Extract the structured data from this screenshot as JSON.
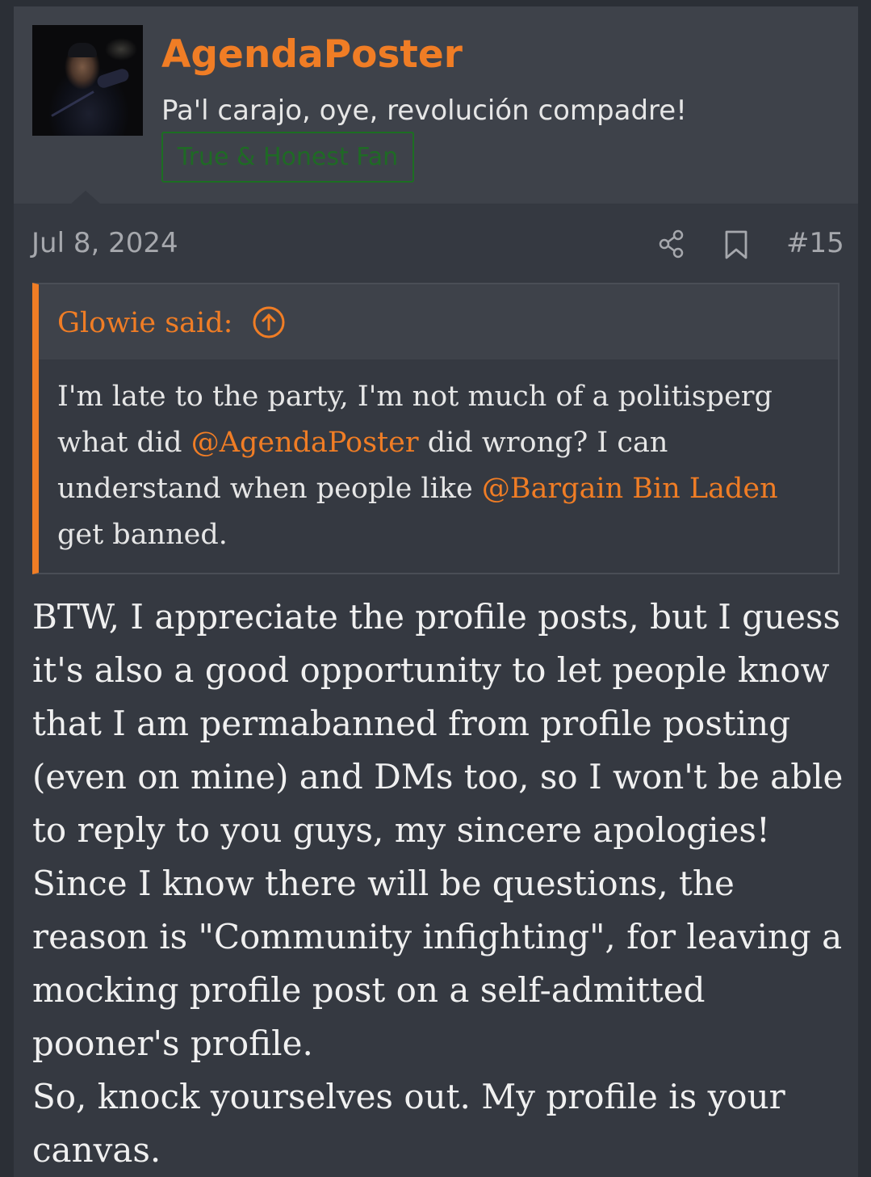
{
  "user": {
    "username": "AgendaPoster",
    "title": "Pa'l carajo, oye, revolución compadre!",
    "banner": "True & Honest Fan"
  },
  "post": {
    "date": "Jul 8, 2024",
    "number": "#15"
  },
  "quote": {
    "author_line": "Glowie said:",
    "lines": [
      {
        "pre": "I'm late to the party, I'm not much of a politisperg",
        "mention": "",
        "post": ""
      },
      {
        "pre": "what did ",
        "mention": "@AgendaPoster",
        "post": " did wrong? I can"
      },
      {
        "pre": "understand when people like ",
        "mention": "@Bargain Bin Laden",
        "post": ""
      },
      {
        "pre": "get banned.",
        "mention": "",
        "post": ""
      }
    ]
  },
  "message": {
    "lines": [
      "BTW, I appreciate the profile posts, but I guess",
      "it's also a good opportunity to let people know",
      "that I am permabanned from profile posting",
      "(even on mine) and DMs too, so I won't be able",
      "to reply to you guys, my sincere apologies!",
      "Since I know there will be questions, the",
      "reason is \"Community infighting\", for leaving a",
      "mocking profile post on a self-admitted",
      "pooner's profile.",
      "So, knock yourselves out. My profile is your",
      "canvas."
    ]
  },
  "icons": {
    "share": "share-icon",
    "bookmark": "bookmark-icon",
    "quote_jump": "arrow-up-circle-icon"
  },
  "colors": {
    "accent": "#f07d25",
    "banner_green": "#1c6e22",
    "background": "#353941",
    "header_background": "#3e424a"
  }
}
